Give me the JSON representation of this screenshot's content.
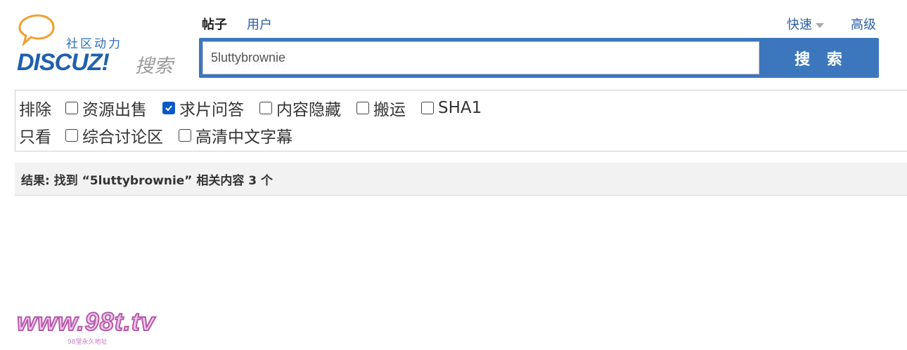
{
  "logo": {
    "tagline": "社区动力",
    "brand": "DISCUZ!",
    "brand_sub": "搜索"
  },
  "tabs": [
    {
      "label": "帖子",
      "active": true
    },
    {
      "label": "用户",
      "active": false
    }
  ],
  "links": {
    "quick": "快速",
    "advanced": "高级"
  },
  "search": {
    "value": "5luttybrownie",
    "button_label": "搜 索"
  },
  "filters": {
    "exclude_label": "排除",
    "exclude_options": [
      {
        "label": "资源出售",
        "checked": false
      },
      {
        "label": "求片问答",
        "checked": true
      },
      {
        "label": "内容隐藏",
        "checked": false
      },
      {
        "label": "搬运",
        "checked": false
      },
      {
        "label": "SHA1",
        "checked": false
      }
    ],
    "only_label": "只看",
    "only_options": [
      {
        "label": "综合讨论区",
        "checked": false
      },
      {
        "label": "高清中文字幕",
        "checked": false
      }
    ]
  },
  "results": {
    "text": "结果: 找到 “5luttybrownie” 相关内容 3 个"
  },
  "watermark": {
    "main": "www.98t.tv",
    "sub": "98堂永久地址"
  },
  "colors": {
    "accent": "#3c77bd",
    "link": "#2b5ea8",
    "checkbox": "#0a58ca"
  }
}
